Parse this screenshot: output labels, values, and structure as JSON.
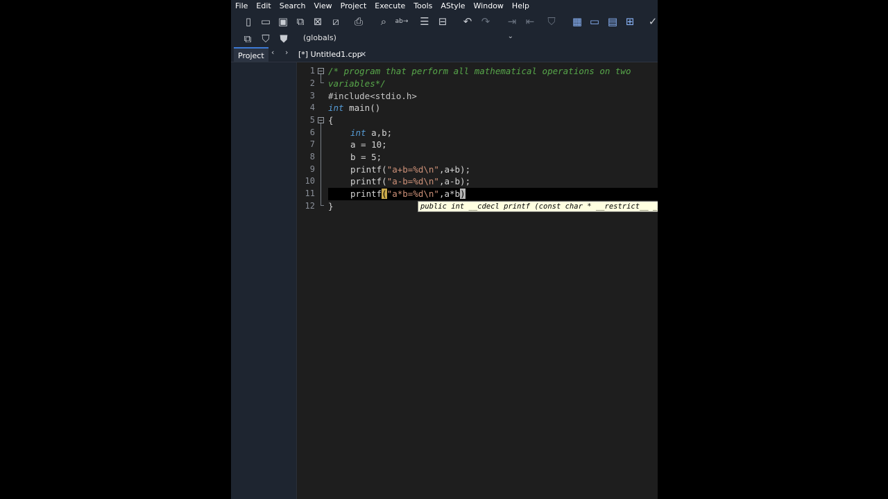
{
  "menu": [
    "File",
    "Edit",
    "Search",
    "View",
    "Project",
    "Execute",
    "Tools",
    "AStyle",
    "Window",
    "Help"
  ],
  "toolbar": {
    "scope_combo": "(globals)"
  },
  "tabs": {
    "project_label": "Project",
    "prev_arrow": "‹",
    "next_arrow": "›",
    "file_label": "[*] Untitled1.cpp",
    "close_glyph": "✕"
  },
  "editor": {
    "line_numbers": [
      "1",
      "2",
      "3",
      "4",
      "5",
      "6",
      "7",
      "8",
      "9",
      "10",
      "11",
      "12"
    ],
    "lines": {
      "l1": "/* program that perform all mathematical operations on two",
      "l2": "variables*/",
      "l3": "#include<stdio.h>",
      "l4_kw": "int",
      "l4_rest": " main()",
      "l5": "{",
      "l6_kw": "int",
      "l6_rest": " a,b;",
      "l7": "a = 10;",
      "l8": "b = 5;",
      "l9_fn": "printf(",
      "l9_str": "\"a+b=%d\\n\"",
      "l9_rest": ",a+b);",
      "l10_fn": "printf(",
      "l10_str": "\"a-b=%d\\n\"",
      "l10_rest": ",a-b);",
      "l11_fn": "printf",
      "l11_open": "(",
      "l11_str": "\"a*b=%d\\n\"",
      "l11_rest": ",a*b",
      "l11_close": ")",
      "l12": "}"
    },
    "calltip": "public int __cdecl printf (const char * __restrict__ _Format, ...)"
  },
  "icons": {
    "new": "new-file-icon",
    "open": "open-folder-icon",
    "save": "save-icon",
    "save_all": "save-all-icon",
    "close": "close-file-icon",
    "close_all": "close-all-icon",
    "print": "print-icon",
    "find": "find-icon",
    "replace": "replace-icon",
    "indent": "indent-icon",
    "unindent": "unindent-icon",
    "undo": "undo-icon",
    "redo": "redo-icon",
    "compile": "compile-icon",
    "run": "run-icon",
    "debug": "debug-icon",
    "layout1": "layout-grid-icon",
    "layout2": "layout-window-icon",
    "layout3": "layout-split-icon",
    "layout4": "layout-tiles-icon",
    "check": "check-icon",
    "goto": "goto-icon",
    "bookmark": "bookmark-icon",
    "bookmark_toggle": "bookmark-toggle-icon"
  },
  "colors": {
    "comment": "#57a64a",
    "keyword": "#569cd6",
    "string": "#ce9178",
    "accent": "#3d7ad6"
  }
}
